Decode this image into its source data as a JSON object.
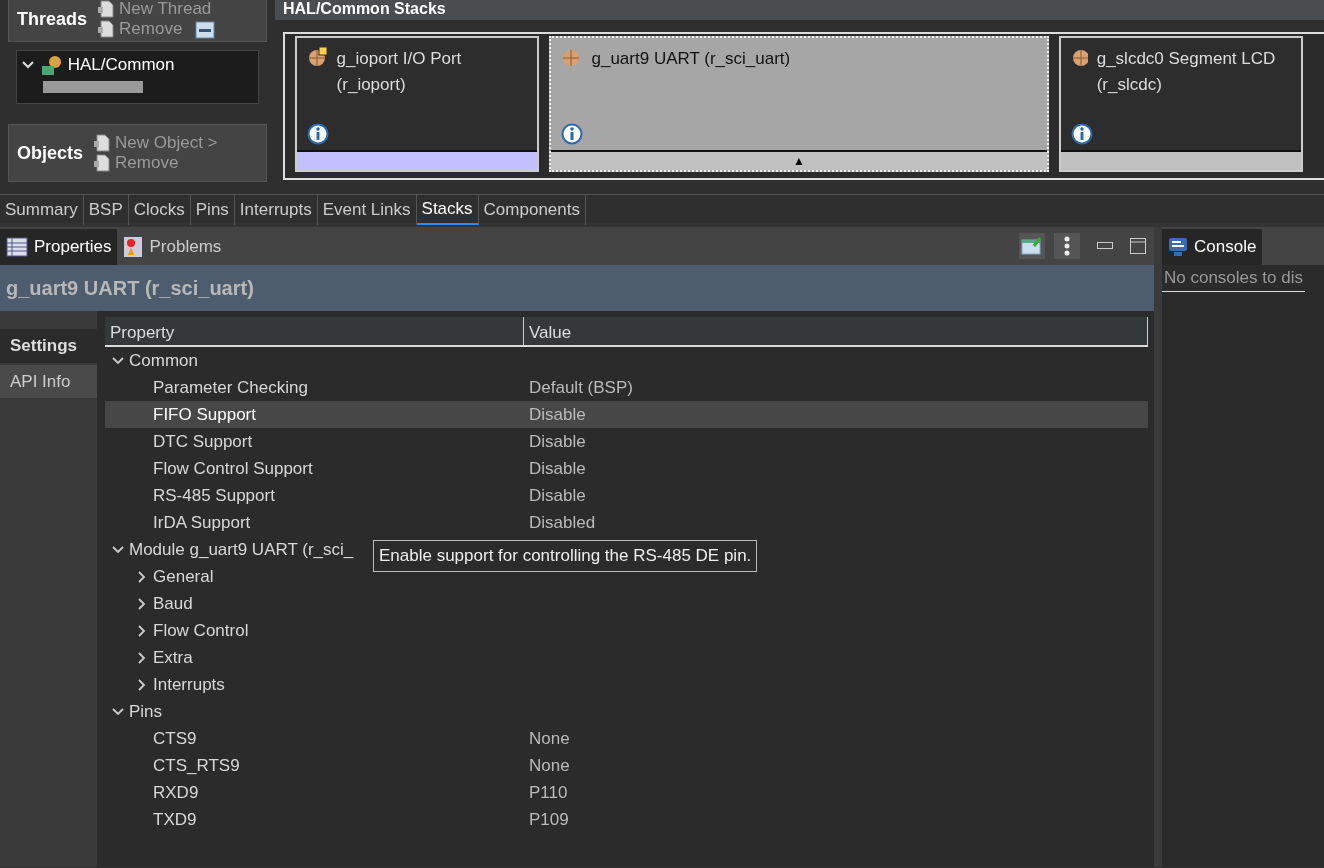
{
  "threads": {
    "title": "Threads",
    "actions": [
      "New Thread",
      "Remove"
    ]
  },
  "thread_tree": [
    {
      "label": "HAL/Common",
      "expanded": true
    }
  ],
  "objects": {
    "title": "Objects",
    "actions": [
      "New Object >",
      "Remove"
    ]
  },
  "stacks": {
    "title": "HAL/Common Stacks",
    "modules": [
      {
        "name": "g_ioport I/O Port (r_ioport)",
        "selected": false,
        "color": "#c4c0ff"
      },
      {
        "name": "g_uart9 UART (r_sci_uart)",
        "selected": true,
        "color": "#c0c0c0",
        "marker": "▲"
      },
      {
        "name": "g_slcdc0 Segment LCD (r_slcdc)",
        "selected": false,
        "color": "#c0c0c0"
      }
    ]
  },
  "editor_tabs": [
    {
      "label": "Summary",
      "selected": false
    },
    {
      "label": "BSP",
      "selected": false
    },
    {
      "label": "Clocks",
      "selected": false
    },
    {
      "label": "Pins",
      "selected": false
    },
    {
      "label": "Interrupts",
      "selected": false
    },
    {
      "label": "Event Links",
      "selected": false
    },
    {
      "label": "Stacks",
      "selected": true
    },
    {
      "label": "Components",
      "selected": false
    }
  ],
  "view_tabs": [
    {
      "label": "Properties",
      "selected": true
    },
    {
      "label": "Problems",
      "selected": false
    }
  ],
  "properties": {
    "title": "g_uart9 UART (r_sci_uart)",
    "side_tabs": [
      {
        "label": "Settings",
        "selected": true
      },
      {
        "label": "API Info",
        "selected": false
      }
    ],
    "columns": [
      "Property",
      "Value"
    ],
    "rows": [
      {
        "label": "Common",
        "expanded": true,
        "children": [
          {
            "label": "Parameter Checking",
            "value": "Default (BSP)",
            "selected": false
          },
          {
            "label": "FIFO Support",
            "value": "Disable",
            "selected": true
          },
          {
            "label": "DTC Support",
            "value": "Disable",
            "selected": false
          },
          {
            "label": "Flow Control Support",
            "value": "Disable",
            "selected": false
          },
          {
            "label": "RS-485 Support",
            "value": "Disable",
            "selected": false
          },
          {
            "label": "IrDA Support",
            "value": "Disabled",
            "selected": false
          }
        ]
      },
      {
        "label": "Module g_uart9 UART (r_sci_",
        "expanded": true,
        "children": [
          {
            "label": "General",
            "expanded": false
          },
          {
            "label": "Baud",
            "expanded": false
          },
          {
            "label": "Flow Control",
            "expanded": false
          },
          {
            "label": "Extra",
            "expanded": false
          },
          {
            "label": "Interrupts",
            "expanded": false
          }
        ]
      },
      {
        "label": "Pins",
        "expanded": true,
        "children": [
          {
            "label": "CTS9",
            "value": "None",
            "selected": false
          },
          {
            "label": "CTS_RTS9",
            "value": "None",
            "selected": false
          },
          {
            "label": "RXD9",
            "value": "P110",
            "selected": false
          },
          {
            "label": "TXD9",
            "value": "P109",
            "selected": false
          }
        ]
      }
    ],
    "tooltip": "Enable support for controlling the RS-485 DE pin."
  },
  "console": {
    "tab": "Console",
    "message": "No consoles to dis"
  }
}
